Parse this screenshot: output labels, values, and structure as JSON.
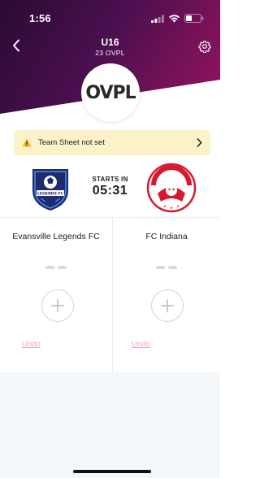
{
  "status_bar": {
    "time": "1:56"
  },
  "nav": {
    "title": "U16",
    "subtitle": "23 OVPL",
    "back_icon": "chevron-left-icon",
    "settings_icon": "gear-icon"
  },
  "league": {
    "logo_text": "OVPL"
  },
  "alert": {
    "text": "Team Sheet not set",
    "icon": "warning-icon",
    "chevron_icon": "chevron-right-icon",
    "background": "#fbf3c7"
  },
  "match": {
    "starts_label": "STARTS IN",
    "countdown": "05:31",
    "home_team": {
      "name": "Evansville Legends FC",
      "badge_text": "LEGENDS FC",
      "score_placeholder": "– –",
      "undo_label": "Undo"
    },
    "away_team": {
      "name": "FC Indiana",
      "badge_text": "FC INDIANA",
      "score_placeholder": "– –",
      "undo_label": "Undo"
    }
  },
  "colors": {
    "header_dark": "#2b0b33",
    "header_magenta": "#8e1460",
    "undo_pink": "#f0a5b9",
    "away_red": "#d7192e",
    "home_navy": "#1e2b6e"
  }
}
